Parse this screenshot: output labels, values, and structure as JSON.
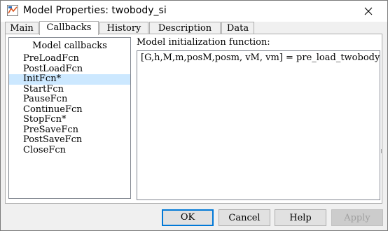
{
  "window": {
    "title": "Model Properties: twobody_si",
    "icon": "simulink-model-icon",
    "close_icon": "close-icon"
  },
  "tabs": [
    {
      "label": "Main",
      "active": false
    },
    {
      "label": "Callbacks",
      "active": true
    },
    {
      "label": "History",
      "active": false
    },
    {
      "label": "Description",
      "active": false
    },
    {
      "label": "Data",
      "active": false
    }
  ],
  "callbacks": {
    "header": "Model callbacks",
    "items": [
      {
        "label": "PreLoadFcn",
        "selected": false
      },
      {
        "label": "PostLoadFcn",
        "selected": false
      },
      {
        "label": "InitFcn*",
        "selected": true
      },
      {
        "label": "StartFcn",
        "selected": false
      },
      {
        "label": "PauseFcn",
        "selected": false
      },
      {
        "label": "ContinueFcn",
        "selected": false
      },
      {
        "label": "StopFcn*",
        "selected": false
      },
      {
        "label": "PreSaveFcn",
        "selected": false
      },
      {
        "label": "PostSaveFcn",
        "selected": false
      },
      {
        "label": "CloseFcn",
        "selected": false
      }
    ]
  },
  "editor": {
    "label": "Model initialization function:",
    "code": "[G,h,M,m,posM,posm, vM, vm] = pre_load_twobody()"
  },
  "buttons": {
    "ok": "OK",
    "cancel": "Cancel",
    "help": "Help",
    "apply": "Apply"
  },
  "colors": {
    "selection": "#cce8ff",
    "default_button_border": "#0078d7"
  }
}
